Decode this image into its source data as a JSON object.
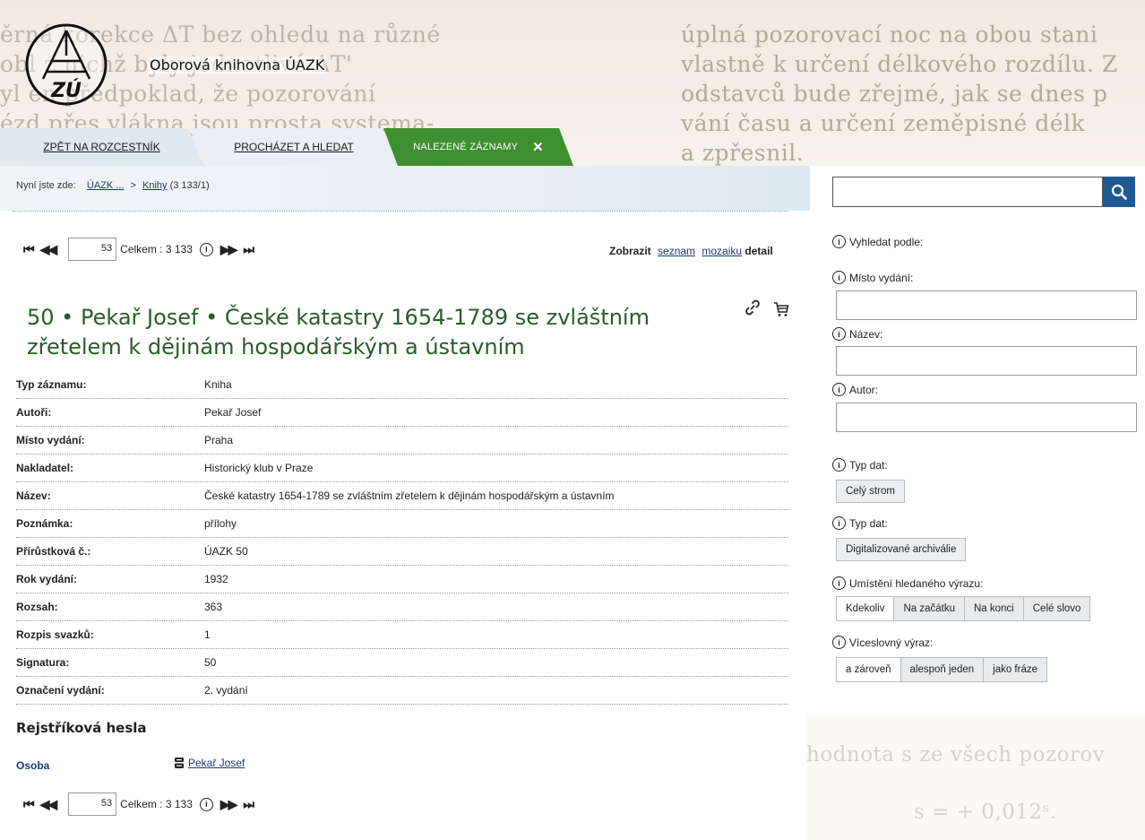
{
  "header": {
    "background_text_left": [
      "ěrná korekce ΔT bez ohledu na různé",
      "obl    z nichž byly jednotlivé ΔT'",
      "yl    en předpoklad, že pozorování",
      "ézd přes vlákna jsou prosta systema-"
    ],
    "background_text_right": [
      "úplná pozorovací noc na obou stani",
      "vlastně k určení délkového rozdílu. Z",
      "odstavců bude zřejmé, jak se dnes p",
      "vání času a určení zeměpisné délk",
      "a zpřesnil."
    ],
    "logo_text": "ZÚ",
    "site_title": "Oborová knihovna ÚAZK"
  },
  "tabs": [
    {
      "label": "ZPĚT NA ROZCESTNÍK"
    },
    {
      "label": "PROCHÁZET A HLEDAT"
    },
    {
      "label": "NALEZENÉ ZÁZNAMY",
      "close": "✕"
    }
  ],
  "breadcrumb": {
    "prefix": "Nyní jste zde:",
    "items": [
      "ÚAZK ...",
      "Knihy"
    ],
    "separator": ">",
    "count": "(3 133/1)"
  },
  "search": {
    "value": "",
    "icon": "search-icon"
  },
  "pager": {
    "current": "53",
    "total_label": "Celkem : 3 133",
    "info": "i",
    "first": "⏮",
    "prev": "◀◀",
    "next": "▶▶",
    "last": "⏭"
  },
  "view_mode": {
    "label": "Zobrazit",
    "list": "seznam",
    "mosaic": "mozaiku",
    "detail": "detail"
  },
  "record": {
    "title": "50 • Pekař Josef • České katastry 1654-1789 se zvláštním zřetelem k dějinám hospodářským a ústavním",
    "rows": [
      {
        "key": "Typ záznamu:",
        "value": "Kniha"
      },
      {
        "key": "Autoři:",
        "value": "Pekař Josef"
      },
      {
        "key": "Místo vydání:",
        "value": "Praha"
      },
      {
        "key": "Nakladatel:",
        "value": "Historický klub v Praze"
      },
      {
        "key": "Název:",
        "value": "České katastry 1654-1789 se zvláštním zřetelem k dějinám hospodářským a ústavním"
      },
      {
        "key": "Poznámka:",
        "value": "přílohy"
      },
      {
        "key": "Přírůstková č.:",
        "value": "ÚAZK 50"
      },
      {
        "key": "Rok vydání:",
        "value": "1932"
      },
      {
        "key": "Rozsah:",
        "value": "363"
      },
      {
        "key": "Rozpis svazků:",
        "value": "1"
      },
      {
        "key": "Signatura:",
        "value": "50"
      },
      {
        "key": "Označení vydání:",
        "value": "2. vydání"
      }
    ]
  },
  "index": {
    "heading": "Rejstříková hesla",
    "type": "Osoba",
    "value": "Pekař Josef"
  },
  "right_panel": {
    "search_by": "Vyhledat podle:",
    "place_label": "Místo vydání:",
    "title_label": "Název:",
    "author_label": "Autor:",
    "data_type_label_1": "Typ dat:",
    "data_type_button_1": "Celý strom",
    "data_type_label_2": "Typ dat:",
    "data_type_button_2": "Digitalizované archiválie",
    "position_label": "Umístění hledaného výrazu:",
    "position_options": [
      "Kdekoliv",
      "Na začátku",
      "Na konci",
      "Celé slovo"
    ],
    "multiword_label": "Víceslovný výraz:",
    "multiword_options": [
      "a zároveň",
      "alespoň jeden",
      "jako fráze"
    ]
  },
  "background_bottom_right": [
    "hodnota s ze všech pozorov",
    "s = + 0,012ˢ."
  ],
  "colors": {
    "accent_green": "#3e8f2f",
    "title_green": "#2a5c2a",
    "search_blue": "#1f5a94",
    "link_blue": "#1a3a7a"
  }
}
